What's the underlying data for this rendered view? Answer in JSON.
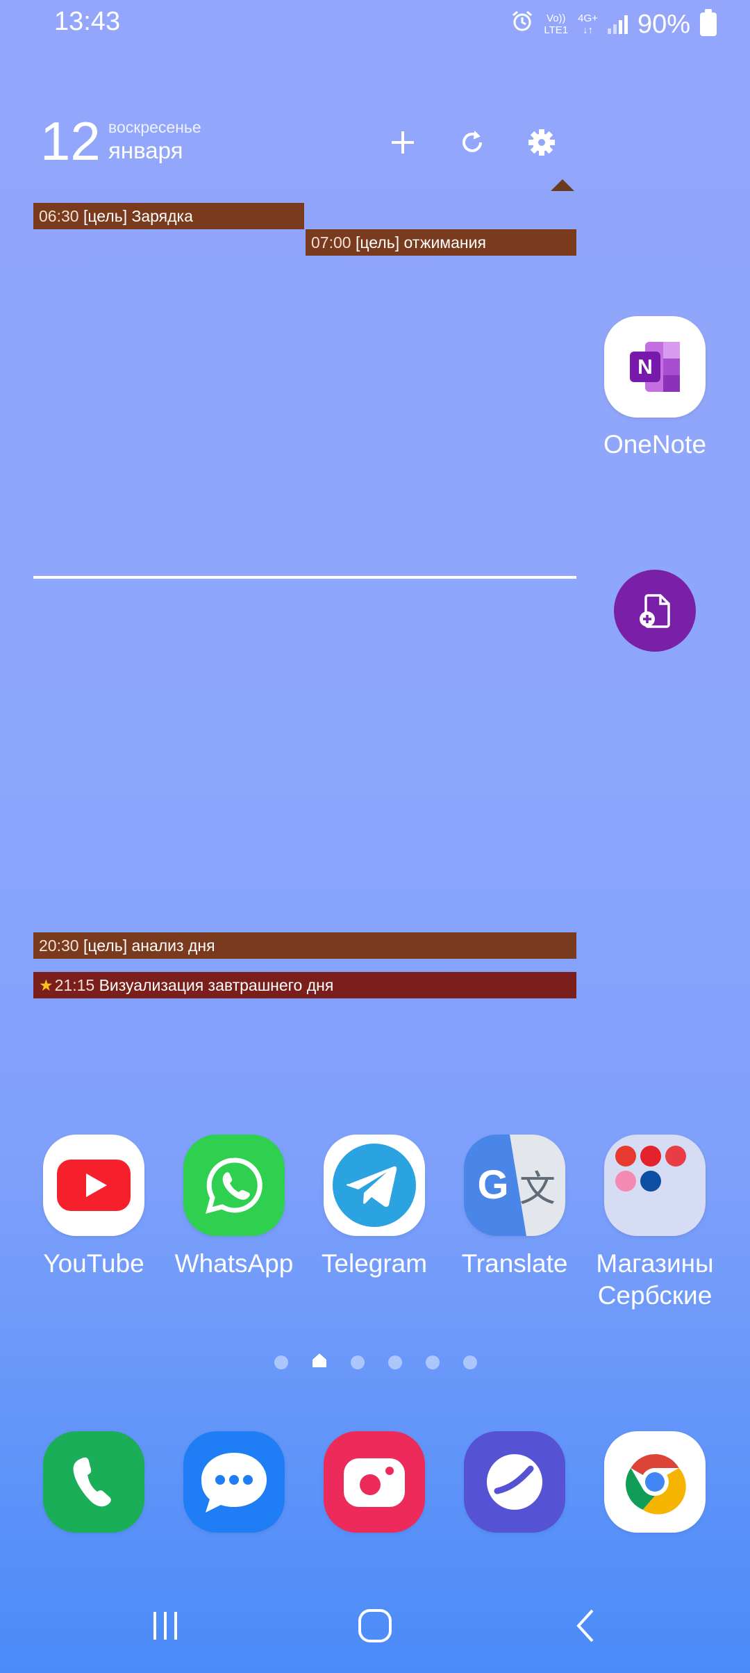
{
  "status_bar": {
    "time": "13:43",
    "net_top": "Vo)) ",
    "net_bottom": "LTE1",
    "gen_top": "4G+",
    "gen_bottom": "↓↑",
    "battery": "90%"
  },
  "calendar_widget": {
    "day": "12",
    "weekday": "воскресенье",
    "month": "января",
    "add_icon": "plus-icon",
    "refresh_icon": "refresh-icon",
    "settings_icon": "gear-icon",
    "events": [
      {
        "time": "06:30",
        "title": "[цель] Зарядка",
        "color": "#7a3a1e"
      },
      {
        "time": "07:00",
        "title": "[цель] отжимания",
        "color": "#7a3a1e"
      },
      {
        "time": "20:30",
        "title": "[цель] анализ дня",
        "color": "#7a3a1e"
      },
      {
        "time": "21:15",
        "title": "Визуализация завтрашнего дня",
        "color": "#7a1f1b",
        "starred": true
      }
    ]
  },
  "home_apps": {
    "onenote": {
      "label": "OneNote",
      "color": "#7b2fb3"
    },
    "new_note_button": {
      "icon": "file-add-icon",
      "color": "#7a1fa8"
    }
  },
  "app_row": [
    {
      "label": "YouTube",
      "icon": "youtube-icon"
    },
    {
      "label": "WhatsApp",
      "icon": "whatsapp-icon"
    },
    {
      "label": "Telegram",
      "icon": "telegram-icon"
    },
    {
      "label": "Translate",
      "icon": "google-translate-icon"
    },
    {
      "label": "Магазины\nСербские",
      "label_line1": "Магазины",
      "label_line2": "Сербские",
      "icon": "folder-icon"
    }
  ],
  "page_indicator": {
    "pages": 6,
    "current": 2
  },
  "dock": [
    {
      "name": "phone",
      "icon": "phone-icon",
      "color": "#1aae59"
    },
    {
      "name": "messages",
      "icon": "message-icon",
      "color": "#1f7ef5"
    },
    {
      "name": "camera",
      "icon": "camera-icon",
      "color": "#ec2b5a"
    },
    {
      "name": "internet",
      "icon": "samsung-internet-icon",
      "color": "#5552d4"
    },
    {
      "name": "chrome",
      "icon": "chrome-icon",
      "color": "#ffffff"
    }
  ],
  "nav_bar": {
    "recents_icon": "recents-icon",
    "home_icon": "home-button-icon",
    "back_icon": "back-icon"
  }
}
